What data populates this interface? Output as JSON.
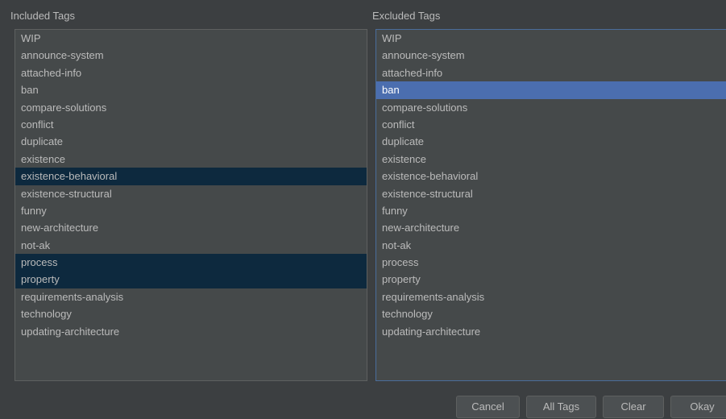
{
  "included": {
    "title": "Included Tags",
    "items": [
      {
        "label": "WIP",
        "state": ""
      },
      {
        "label": "announce-system",
        "state": ""
      },
      {
        "label": "attached-info",
        "state": ""
      },
      {
        "label": "ban",
        "state": ""
      },
      {
        "label": "compare-solutions",
        "state": ""
      },
      {
        "label": "conflict",
        "state": ""
      },
      {
        "label": "duplicate",
        "state": ""
      },
      {
        "label": "existence",
        "state": ""
      },
      {
        "label": "existence-behavioral",
        "state": "sel-dim"
      },
      {
        "label": "existence-structural",
        "state": ""
      },
      {
        "label": "funny",
        "state": ""
      },
      {
        "label": "new-architecture",
        "state": ""
      },
      {
        "label": "not-ak",
        "state": ""
      },
      {
        "label": "process",
        "state": "sel-dim"
      },
      {
        "label": "property",
        "state": "sel-dim"
      },
      {
        "label": "requirements-analysis",
        "state": ""
      },
      {
        "label": "technology",
        "state": ""
      },
      {
        "label": "updating-architecture",
        "state": ""
      }
    ]
  },
  "excluded": {
    "title": "Excluded Tags",
    "items": [
      {
        "label": "WIP",
        "state": ""
      },
      {
        "label": "announce-system",
        "state": ""
      },
      {
        "label": "attached-info",
        "state": ""
      },
      {
        "label": "ban",
        "state": "sel-active"
      },
      {
        "label": "compare-solutions",
        "state": ""
      },
      {
        "label": "conflict",
        "state": ""
      },
      {
        "label": "duplicate",
        "state": ""
      },
      {
        "label": "existence",
        "state": ""
      },
      {
        "label": "existence-behavioral",
        "state": ""
      },
      {
        "label": "existence-structural",
        "state": ""
      },
      {
        "label": "funny",
        "state": ""
      },
      {
        "label": "new-architecture",
        "state": ""
      },
      {
        "label": "not-ak",
        "state": ""
      },
      {
        "label": "process",
        "state": ""
      },
      {
        "label": "property",
        "state": ""
      },
      {
        "label": "requirements-analysis",
        "state": ""
      },
      {
        "label": "technology",
        "state": ""
      },
      {
        "label": "updating-architecture",
        "state": ""
      }
    ]
  },
  "buttons": {
    "cancel": "Cancel",
    "all_tags": "All Tags",
    "clear": "Clear",
    "okay": "Okay"
  },
  "colors": {
    "background": "#3c3f41",
    "list_background": "#45494a",
    "inactive_selection": "#0d293e",
    "active_selection": "#4b6eaf"
  }
}
